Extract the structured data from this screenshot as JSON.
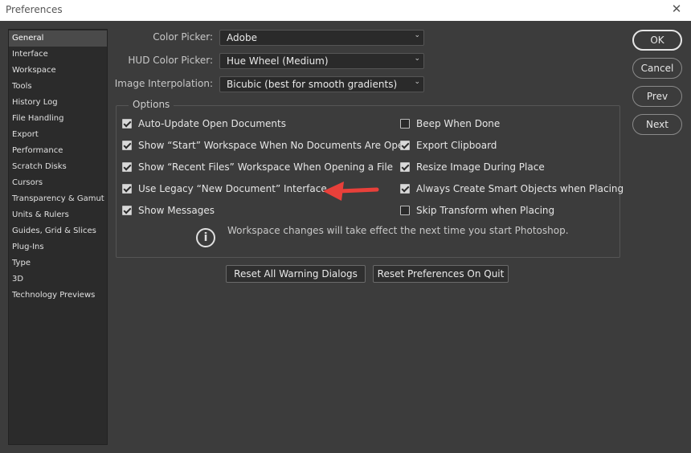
{
  "window": {
    "title": "Preferences",
    "close_glyph": "✕"
  },
  "sidebar": {
    "items": [
      {
        "label": "General",
        "active": true
      },
      {
        "label": "Interface"
      },
      {
        "label": "Workspace"
      },
      {
        "label": "Tools"
      },
      {
        "label": "History Log"
      },
      {
        "label": "File Handling"
      },
      {
        "label": "Export"
      },
      {
        "label": "Performance"
      },
      {
        "label": "Scratch Disks"
      },
      {
        "label": "Cursors"
      },
      {
        "label": "Transparency & Gamut"
      },
      {
        "label": "Units & Rulers"
      },
      {
        "label": "Guides, Grid & Slices"
      },
      {
        "label": "Plug-Ins"
      },
      {
        "label": "Type"
      },
      {
        "label": "3D"
      },
      {
        "label": "Technology Previews"
      }
    ]
  },
  "fields": {
    "color_picker": {
      "label": "Color Picker:",
      "value": "Adobe"
    },
    "hud_color_picker": {
      "label": "HUD Color Picker:",
      "value": "Hue Wheel (Medium)"
    },
    "image_interpolation": {
      "label": "Image Interpolation:",
      "value": "Bicubic (best for smooth gradients)"
    }
  },
  "options": {
    "title": "Options",
    "left": [
      {
        "label": "Auto-Update Open Documents",
        "checked": true
      },
      {
        "label": "Show “Start” Workspace When No Documents Are Open",
        "checked": true
      },
      {
        "label": "Show “Recent Files” Workspace When Opening a File",
        "checked": true
      },
      {
        "label": "Use Legacy “New Document” Interface",
        "checked": true
      },
      {
        "label": "Show Messages",
        "checked": true
      }
    ],
    "right": [
      {
        "label": "Beep When Done",
        "checked": false
      },
      {
        "label": "Export Clipboard",
        "checked": true
      },
      {
        "label": "Resize Image During Place",
        "checked": true
      },
      {
        "label": "Always Create Smart Objects when Placing",
        "checked": true
      },
      {
        "label": "Skip Transform when Placing",
        "checked": false
      }
    ],
    "info_icon_glyph": "i",
    "info_text": "Workspace changes will take effect the next time you start Photoshop."
  },
  "buttons": {
    "reset_warnings": "Reset All Warning Dialogs",
    "reset_on_quit": "Reset Preferences On Quit",
    "ok": "OK",
    "cancel": "Cancel",
    "prev": "Prev",
    "next": "Next"
  },
  "colors": {
    "annotation_arrow": "#e8403a",
    "panel_bg": "#3c3c3c",
    "sidebar_bg": "#2b2b2b"
  },
  "icons": {
    "dropdown": "chevron-down-icon",
    "info": "info-icon",
    "close": "close-icon"
  }
}
